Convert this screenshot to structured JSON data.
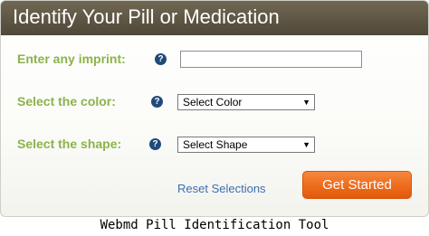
{
  "header": {
    "title": "Identify Your Pill or Medication"
  },
  "form": {
    "imprint": {
      "label": "Enter any imprint:",
      "value": "",
      "help_icon": "help-icon"
    },
    "color": {
      "label": "Select the color:",
      "selected": "Select Color",
      "help_icon": "help-icon"
    },
    "shape": {
      "label": "Select the shape:",
      "selected": "Select Shape",
      "help_icon": "help-icon"
    },
    "help_glyph": "?",
    "dropdown_glyph": "▼",
    "reset_label": "Reset Selections",
    "submit_label": "Get Started"
  },
  "caption": "Webmd Pill Identification Tool",
  "colors": {
    "header_bg": "#5e5644",
    "label_green": "#8cb34a",
    "link_blue": "#3b6fb1",
    "button_orange": "#ee6b1c",
    "help_blue": "#1f4a7a"
  }
}
